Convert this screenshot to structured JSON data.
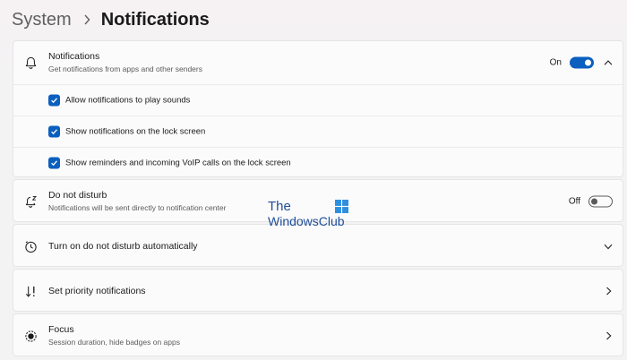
{
  "breadcrumb": {
    "parent": "System",
    "separator_icon": "chevron-right-icon",
    "current": "Notifications"
  },
  "notifications": {
    "icon": "bell-icon",
    "title": "Notifications",
    "subtitle": "Get notifications from apps and other senders",
    "toggle_state": "On",
    "toggle_on": true,
    "expanded": true,
    "options": [
      {
        "label": "Allow notifications to play sounds",
        "checked": true
      },
      {
        "label": "Show notifications on the lock screen",
        "checked": true
      },
      {
        "label": "Show reminders and incoming VoIP calls on the lock screen",
        "checked": true
      }
    ]
  },
  "do_not_disturb": {
    "icon": "bell-snooze-icon",
    "title": "Do not disturb",
    "subtitle": "Notifications will be sent directly to notification center",
    "toggle_state": "Off",
    "toggle_on": false
  },
  "auto_dnd": {
    "icon": "clock-icon",
    "title": "Turn on do not disturb automatically",
    "chevron": "chevron-down-icon"
  },
  "priority": {
    "icon": "priority-icon",
    "title": "Set priority notifications",
    "chevron": "chevron-right-icon"
  },
  "focus": {
    "icon": "focus-icon",
    "title": "Focus",
    "subtitle": "Session duration, hide badges on apps",
    "chevron": "chevron-right-icon"
  },
  "watermark": {
    "line1": "The",
    "line2": "WindowsClub",
    "logo": "windows-logo"
  },
  "colors": {
    "accent": "#0a5fbf",
    "background": "#f3f3f3",
    "card": "#fbfbfb",
    "watermark_blue": "#1f4e9a"
  }
}
